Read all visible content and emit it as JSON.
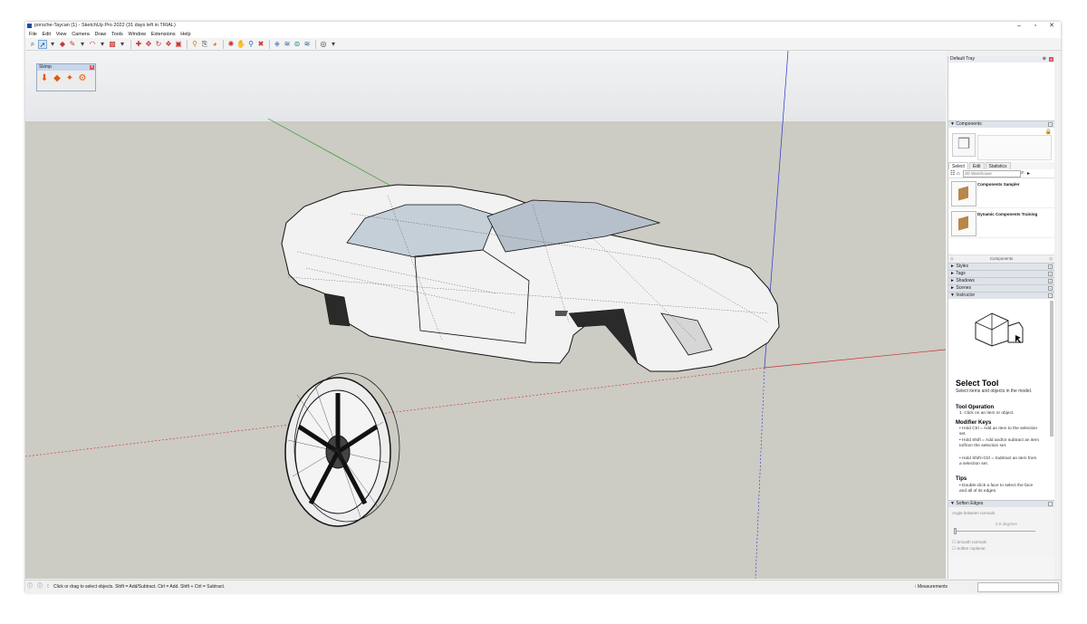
{
  "window": {
    "title": "porsche-Taycan (1) - SketchUp Pro 2022 (31 days left in TRIAL)",
    "controls": [
      "–",
      "▫",
      "✕"
    ]
  },
  "menu": [
    "File",
    "Edit",
    "View",
    "Camera",
    "Draw",
    "Tools",
    "Window",
    "Extensions",
    "Help"
  ],
  "toolbar": {
    "icons": [
      "zoom-icon",
      "select-arrow-icon",
      "eraser-icon",
      "pencil-line-icon",
      "arc-icon",
      "shape-rectangle-icon",
      "push-pull-icon",
      "move-icon",
      "rotate-icon",
      "follow-me-icon",
      "scale-icon",
      "tape-measure-icon",
      "text-icon",
      "paint-bucket-icon",
      "orbit-icon",
      "pan-icon",
      "zoom-tool-icon",
      "zoom-extents-icon",
      "3d-warehouse-icon",
      "extension-warehouse-icon",
      "layout-icon",
      "styles-icon",
      "account-icon"
    ]
  },
  "skimp": {
    "title": "Skimp",
    "close": "x"
  },
  "tray": {
    "title": "Default Tray",
    "pin": "⊕",
    "close": "x",
    "components": {
      "header": "Components",
      "tabs": [
        "Select",
        "Edit",
        "Statistics"
      ],
      "search_placeholder": "3D Warehouse",
      "items": [
        "Components Sampler",
        "Dynamic Components Training"
      ],
      "footer": "Components"
    },
    "sections": [
      "Styles",
      "Tags",
      "Shadows",
      "Scenes",
      "Instructor"
    ],
    "instructor": {
      "title": "Select Tool",
      "subtitle": "Select items and objects in the model.",
      "h_operation": "Tool Operation",
      "operation": "1. Click on an item or object.",
      "h_modifier": "Modifier Keys",
      "mod1": "• Hold Ctrl = Add an item to the selection set.",
      "mod2": "• Hold Shift = Add and/or subtract an item to/from the selection set.",
      "mod3": "• Hold Shift+Ctrl = Subtract an item from a selection set.",
      "h_tips": "Tips",
      "tips": "• Double-click a face to select the face and all of its edges."
    },
    "soften": {
      "header": "Soften Edges",
      "angle_label": "Angle between normals:",
      "degrees": "0.0  degrees",
      "smooth": "Smooth normals",
      "coplanar": "Soften coplanar"
    }
  },
  "status": {
    "message": "Click or drag to select objects. Shift = Add/Subtract. Ctrl = Add. Shift + Ctrl = Subtract.",
    "measurements_label": "Measurements",
    "measurements_value": ""
  },
  "colors": {
    "axis_red": "#c8302a",
    "axis_green": "#2a9a2a",
    "axis_blue": "#2a34c8",
    "close_red": "#d9534f"
  }
}
